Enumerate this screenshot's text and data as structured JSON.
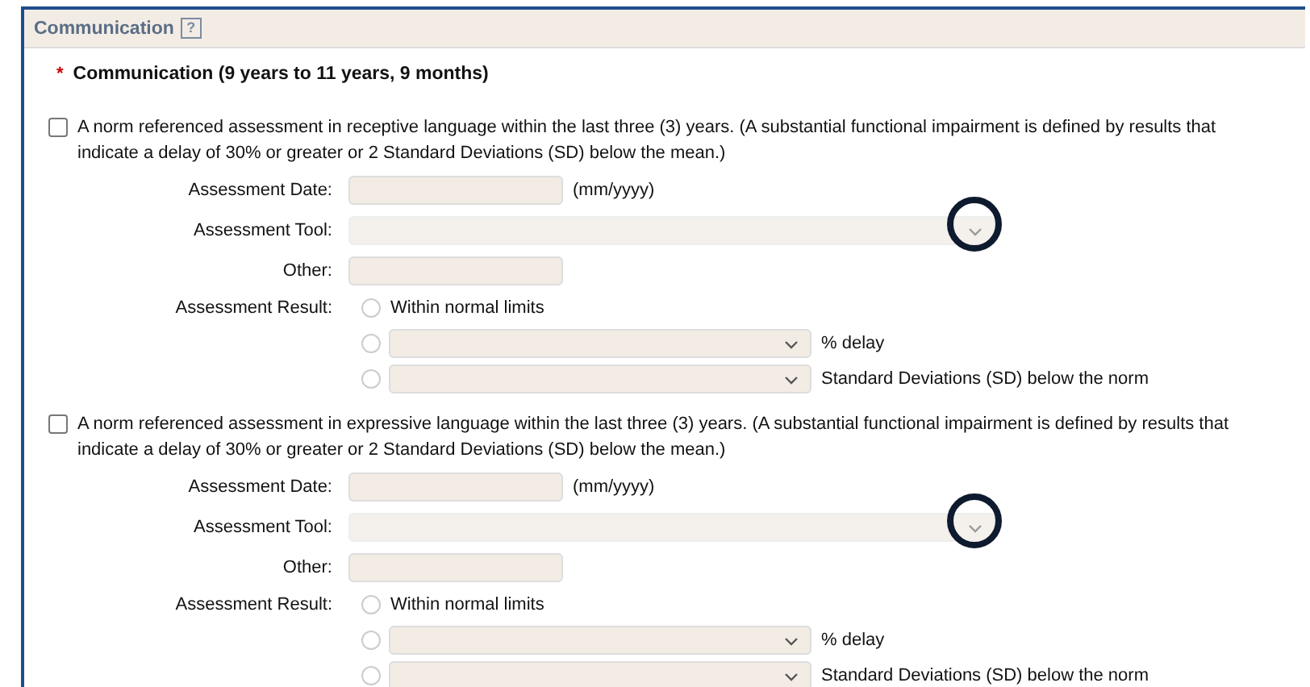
{
  "section": {
    "title": "Communication",
    "help": "?"
  },
  "heading": {
    "required_mark": "*",
    "text": "Communication (9 years to 11 years, 9 months)"
  },
  "assessments": [
    {
      "checked": false,
      "text": "A norm referenced assessment in receptive language within the last three (3) years. (A substantial functional impairment is defined by results that indicate a delay of 30% or greater or 2 Standard Deviations (SD) below the mean.)",
      "date_label": "Assessment Date:",
      "date_hint": "(mm/yyyy)",
      "tool_label": "Assessment Tool:",
      "tool_highlighted": true,
      "other_label": "Other:",
      "result_label": "Assessment Result:",
      "results": [
        {
          "kind": "plain",
          "selected": false,
          "label": "Within normal limits"
        },
        {
          "kind": "select",
          "selected": false,
          "label": "% delay"
        },
        {
          "kind": "select",
          "selected": false,
          "label": "Standard Deviations (SD) below the norm"
        }
      ]
    },
    {
      "checked": false,
      "text": "A norm referenced assessment in expressive language within the last three (3) years. (A substantial functional impairment is defined by results that indicate a delay of 30% or greater or 2 Standard Deviations (SD) below the mean.)",
      "date_label": "Assessment Date:",
      "date_hint": "(mm/yyyy)",
      "tool_label": "Assessment Tool:",
      "tool_highlighted": true,
      "other_label": "Other:",
      "result_label": "Assessment Result:",
      "results": [
        {
          "kind": "plain",
          "selected": false,
          "label": "Within normal limits"
        },
        {
          "kind": "select",
          "selected": false,
          "label": "% delay"
        },
        {
          "kind": "select",
          "selected": false,
          "label": "Standard Deviations (SD) below the norm"
        }
      ]
    }
  ]
}
